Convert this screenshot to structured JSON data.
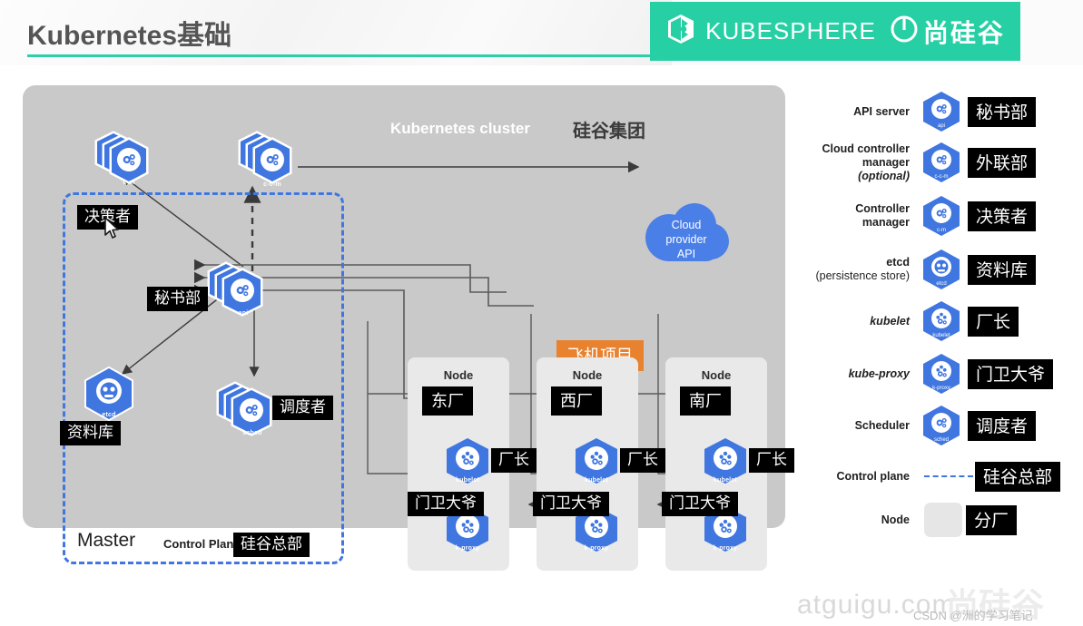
{
  "header": {
    "title": "Kubernetes基础",
    "brand_primary": "KUBESPHERE",
    "brand_secondary": "尚硅谷",
    "brand_color": "#27cfa4",
    "underline_color": "#2ecfa8",
    "kubesphere_icon": "kubesphere-logo-icon",
    "atguigu_icon": "atguigu-power-icon"
  },
  "diagram": {
    "cluster_title": "Kubernetes cluster",
    "cluster_title_cn": "硅谷集团",
    "panel_color": "#c9c9c9",
    "control_plane_border_color": "#3f76e0",
    "master_word": "Master",
    "control_plane_word": "Control Plane",
    "control_plane_tag": "硅谷总部",
    "cloud": {
      "line1": "Cloud",
      "line2": "provider",
      "line3": "API",
      "color": "#4a7fe8"
    },
    "project_tag": {
      "label": "飞机项目",
      "color": "#e8822f"
    },
    "components": [
      {
        "icon": "c-m",
        "tag": "决策者"
      },
      {
        "icon": "c-c-m",
        "tag": ""
      },
      {
        "icon": "api",
        "tag": "秘书部"
      },
      {
        "icon": "etcd",
        "tag": "资料库"
      },
      {
        "icon": "sched",
        "tag": "调度者"
      }
    ],
    "nodes": [
      {
        "word": "Node",
        "tag": "东厂",
        "kubelet_icon": "kubelet",
        "kubelet_tag": "厂长",
        "proxy_icon": "k-proxy",
        "proxy_tag": "门卫大爷"
      },
      {
        "word": "Node",
        "tag": "西厂",
        "kubelet_icon": "kubelet",
        "kubelet_tag": "厂长",
        "proxy_icon": "k-proxy",
        "proxy_tag": "门卫大爷"
      },
      {
        "word": "Node",
        "tag": "南厂",
        "kubelet_icon": "kubelet",
        "kubelet_tag": "厂长",
        "proxy_icon": "k-proxy",
        "proxy_tag": "门卫大爷"
      }
    ]
  },
  "legend": {
    "rows": [
      {
        "label": "API server",
        "sub": "",
        "optional": "",
        "icon": "api",
        "tag": "秘书部",
        "type": "icon",
        "italic": false
      },
      {
        "label": "Cloud controller",
        "sub": "manager",
        "optional": "(optional)",
        "icon": "c-c-m",
        "tag": "外联部",
        "type": "icon",
        "italic": false
      },
      {
        "label": "Controller",
        "sub": "manager",
        "optional": "",
        "icon": "c-m",
        "tag": "决策者",
        "type": "icon",
        "italic": false
      },
      {
        "label": "etcd",
        "sub": "(persistence store)",
        "optional": "",
        "icon": "etcd",
        "tag": "资料库",
        "type": "icon",
        "italic": false
      },
      {
        "label": "kubelet",
        "sub": "",
        "optional": "",
        "icon": "kubelet",
        "tag": "厂长",
        "type": "icon",
        "italic": true
      },
      {
        "label": "kube-proxy",
        "sub": "",
        "optional": "",
        "icon": "k-proxy",
        "tag": "门卫大爷",
        "type": "icon",
        "italic": true
      },
      {
        "label": "Scheduler",
        "sub": "",
        "optional": "",
        "icon": "sched",
        "tag": "调度者",
        "type": "icon",
        "italic": false
      },
      {
        "label": "Control plane",
        "sub": "",
        "optional": "",
        "icon": "dashed-line",
        "tag": "硅谷总部",
        "type": "dash",
        "italic": false
      },
      {
        "label": "Node",
        "sub": "",
        "optional": "",
        "icon": "node-swatch",
        "tag": "分厂",
        "type": "swatch",
        "italic": false
      }
    ]
  },
  "watermarks": {
    "atguigu": "atguigu.com",
    "shang": "尚硅谷",
    "csdn": "CSDN @洲的学习笔记"
  }
}
